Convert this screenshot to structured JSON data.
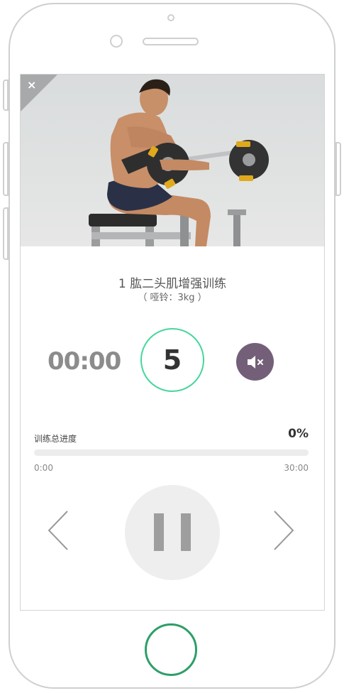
{
  "exercise": {
    "title": "1 肱二头肌增强训练",
    "equipment": "（ 哑铃：3kg ）"
  },
  "close_label": "×",
  "timer": {
    "elapsed": "00:00"
  },
  "rep_counter": "5",
  "progress": {
    "label": "训练总进度",
    "percent_text": "0%",
    "percent_value": 0,
    "start_time": "0:00",
    "end_time": "30:00"
  },
  "colors": {
    "accent_green": "#46d69c",
    "mute_purple": "#736078",
    "home_button_green": "#2e9e68"
  },
  "icons": {
    "close": "close-icon",
    "mute": "volume-mute-icon",
    "prev": "chevron-left-icon",
    "next": "chevron-right-icon",
    "pause": "pause-icon"
  }
}
